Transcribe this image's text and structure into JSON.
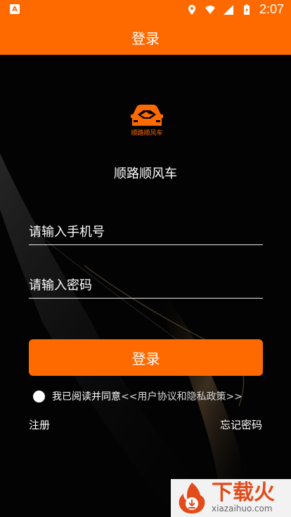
{
  "status_bar": {
    "time": "2:07"
  },
  "app_bar": {
    "title": "登录"
  },
  "brand": {
    "logo_text": "顺路顺风车",
    "app_name": "顺路顺风车"
  },
  "form": {
    "phone_placeholder": "请输入手机号",
    "password_placeholder": "请输入密码",
    "login_label": "登录"
  },
  "agreement": {
    "prefix": "我已阅读并同意",
    "policy_link": "<<用户协议和隐私政策>>"
  },
  "links": {
    "register": "注册",
    "forgot_password": "忘记密码"
  },
  "watermark": {
    "title": "下载火",
    "subtitle": "xiazaihuo.com"
  },
  "colors": {
    "accent": "#ff6a00",
    "background": "#030303"
  }
}
